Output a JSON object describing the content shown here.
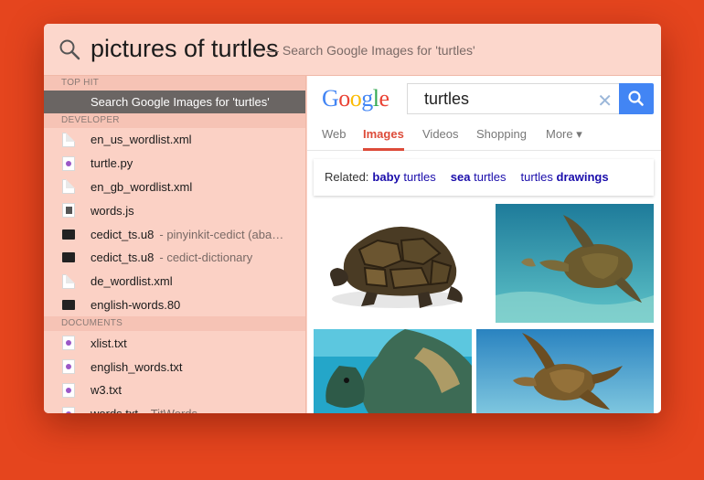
{
  "spotlight": {
    "query": "pictures of turtles",
    "hint": "— Search Google Images for 'turtles'"
  },
  "results": {
    "tophit_header": "TOP HIT",
    "tophit_label": "Search Google Images for 'turtles'",
    "developer_header": "DEVELOPER",
    "developer": [
      {
        "name": "en_us_wordlist.xml",
        "sub": "",
        "icon": "doc-icon"
      },
      {
        "name": "turtle.py",
        "sub": "",
        "icon": "python-file-icon"
      },
      {
        "name": "en_gb_wordlist.xml",
        "sub": "",
        "icon": "doc-icon"
      },
      {
        "name": "words.js",
        "sub": "",
        "icon": "js-file-icon"
      },
      {
        "name": "cedict_ts.u8",
        "sub": "- pinyinkit-cedict (aba…",
        "icon": "terminal-icon"
      },
      {
        "name": "cedict_ts.u8",
        "sub": "- cedict-dictionary",
        "icon": "terminal-icon"
      },
      {
        "name": "de_wordlist.xml",
        "sub": "",
        "icon": "doc-icon"
      },
      {
        "name": "english-words.80",
        "sub": "",
        "icon": "terminal-icon"
      }
    ],
    "documents_header": "DOCUMENTS",
    "documents": [
      {
        "name": "xlist.txt",
        "sub": "",
        "icon": "python-file-icon"
      },
      {
        "name": "english_words.txt",
        "sub": "",
        "icon": "python-file-icon"
      },
      {
        "name": "w3.txt",
        "sub": "",
        "icon": "python-file-icon"
      },
      {
        "name": "words.txt",
        "sub": "- TitWords",
        "icon": "python-file-icon"
      }
    ]
  },
  "google": {
    "logo": [
      "G",
      "o",
      "o",
      "g",
      "l",
      "e"
    ],
    "logo_colors": [
      "#4285f4",
      "#ea4335",
      "#fbbc05",
      "#4285f4",
      "#34a853",
      "#ea4335"
    ],
    "search_value": "turtles",
    "clear": "✕",
    "tabs": [
      "Web",
      "Images",
      "Videos",
      "Shopping",
      "More ▾"
    ],
    "active_tab": "Images",
    "related_label": "Related:",
    "related": [
      {
        "pre": "",
        "bold": "baby",
        "post": " turtles"
      },
      {
        "pre": "",
        "bold": "sea",
        "post": " turtles"
      },
      {
        "pre": "turtles ",
        "bold": "drawings",
        "post": ""
      }
    ]
  },
  "colors": {
    "background": "#e5451e",
    "selected_row": "#6a6563",
    "accent_red": "#dd4b39",
    "link_blue": "#1a0dab"
  }
}
